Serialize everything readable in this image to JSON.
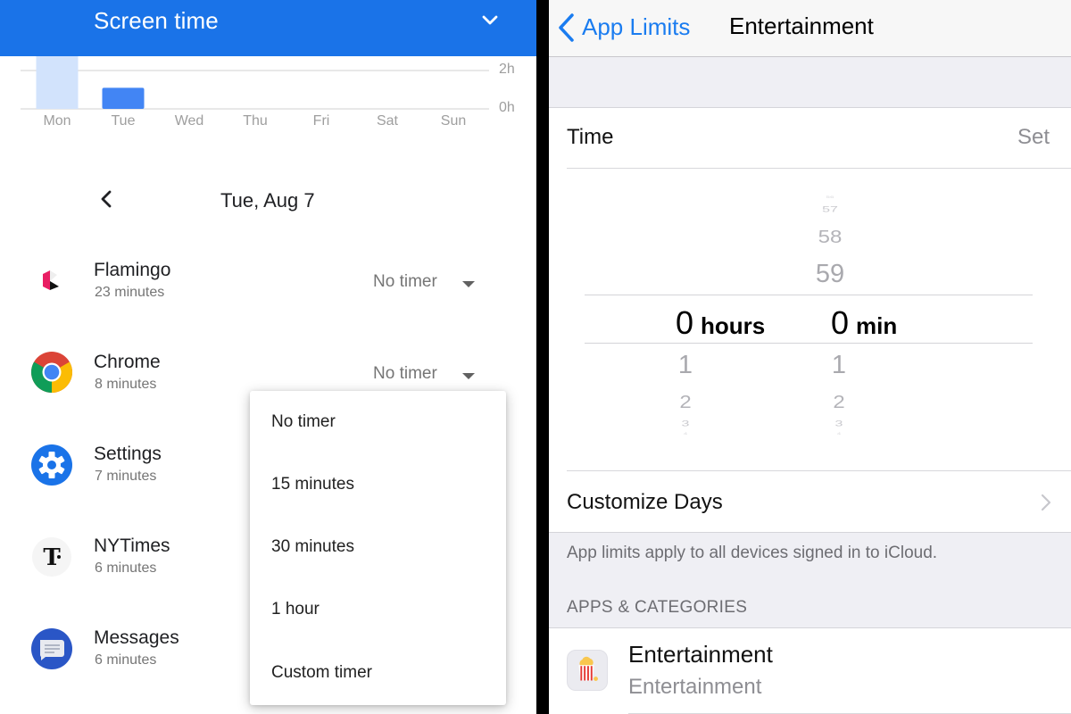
{
  "android": {
    "header": {
      "title": "Screen time",
      "expand_icon": "chevron-down-icon"
    },
    "chart_data": {
      "type": "bar",
      "title": "",
      "xlabel": "",
      "ylabel": "",
      "categories": [
        "Mon",
        "Tue",
        "Wed",
        "Thu",
        "Fri",
        "Sat",
        "Sun"
      ],
      "values": [
        2.8,
        1.1,
        0,
        0,
        0,
        0,
        0
      ],
      "value_note": "Mon bar is clipped by the header; value is at least ~2.8h",
      "selected_category": "Tue",
      "y_ticks": [
        "0h",
        "2h"
      ],
      "ylim_hours": [
        0,
        2.8
      ],
      "grid": true,
      "colors": {
        "selected": "#4285f4",
        "unselected": "#d2e3fc"
      }
    },
    "date_nav": {
      "back_icon": "chevron-left-icon",
      "date": "Tue, Aug 7"
    },
    "apps": [
      {
        "name": "Flamingo",
        "usage": "23 minutes",
        "timer": "No timer",
        "icon": "flamingo-app-icon"
      },
      {
        "name": "Chrome",
        "usage": "8 minutes",
        "timer": "No timer",
        "icon": "chrome-app-icon"
      },
      {
        "name": "Settings",
        "usage": "7 minutes",
        "icon": "settings-app-icon"
      },
      {
        "name": "NYTimes",
        "usage": "6 minutes",
        "icon": "nytimes-app-icon"
      },
      {
        "name": "Messages",
        "usage": "6 minutes",
        "icon": "messages-app-icon"
      }
    ],
    "timer_menu": {
      "options": [
        "No timer",
        "15 minutes",
        "30 minutes",
        "1 hour",
        "Custom timer"
      ]
    }
  },
  "ios": {
    "nav": {
      "back_label": "App Limits",
      "title": "Entertainment"
    },
    "time_row": {
      "label": "Time",
      "action": "Set"
    },
    "picker": {
      "hours": {
        "above": [],
        "selected": "0",
        "below": [
          "1",
          "2",
          "3",
          "4"
        ],
        "unit": "hours"
      },
      "minutes": {
        "above": [
          "56",
          "57",
          "58",
          "59"
        ],
        "selected": "0",
        "below": [
          "1",
          "2",
          "3",
          "4"
        ],
        "unit": "min"
      }
    },
    "customize_days": {
      "label": "Customize Days"
    },
    "footnote": "App limits apply to all devices signed in to iCloud.",
    "section_header": "APPS & CATEGORIES",
    "category": {
      "title": "Entertainment",
      "subtitle": "Entertainment",
      "icon": "popcorn-icon"
    }
  }
}
